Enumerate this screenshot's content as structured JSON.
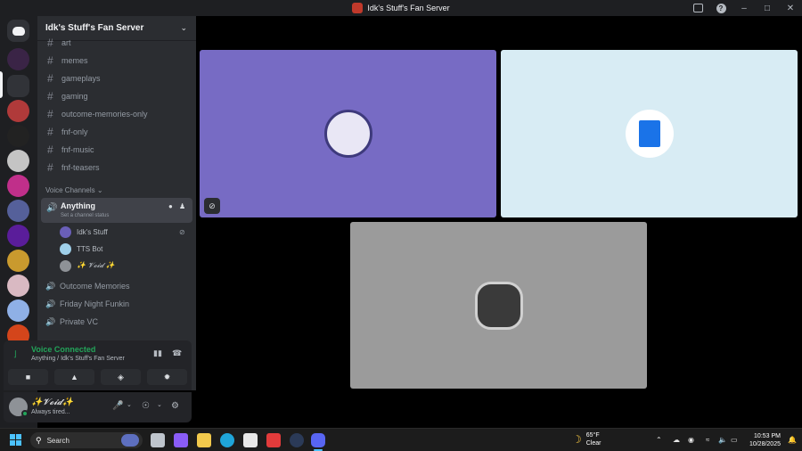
{
  "window": {
    "title": "Idk's Stuff's Fan Server"
  },
  "server": {
    "name": "Idk's Stuff's Fan Server",
    "text_channels": [
      "art",
      "memes",
      "gameplays",
      "gaming",
      "outcome-memories-only",
      "fnf-only",
      "fnf-music",
      "fnf-teasers"
    ],
    "voice_category": "Voice Channels",
    "active_voice": {
      "name": "Anything",
      "status_placeholder": "Set a channel status"
    },
    "voice_users": [
      "Idk's Stuff",
      "TTS Bot",
      "✨ 𝓥𝓸𝓲𝓭 ✨"
    ],
    "other_voice_channels": [
      "Outcome Memories",
      "Friday Night Funkin",
      "Private VC"
    ]
  },
  "voice_panel": {
    "status": "Voice Connected",
    "subtitle": "Anything / Idk's Stuff's Fan Server"
  },
  "user_panel": {
    "name": "✨𝓥𝓸𝓲𝓭✨",
    "status": "Always tired..."
  },
  "taskbar": {
    "search_label": "Search",
    "weather_temp": "65°F",
    "weather_desc": "Clear",
    "time": "10:53 PM",
    "date": "10/28/2025"
  },
  "colors": {
    "tile_1": "#776bc4",
    "tile_2": "#d8ecf4",
    "tile_3": "#9b9b9b",
    "connected_green": "#23a55a"
  }
}
